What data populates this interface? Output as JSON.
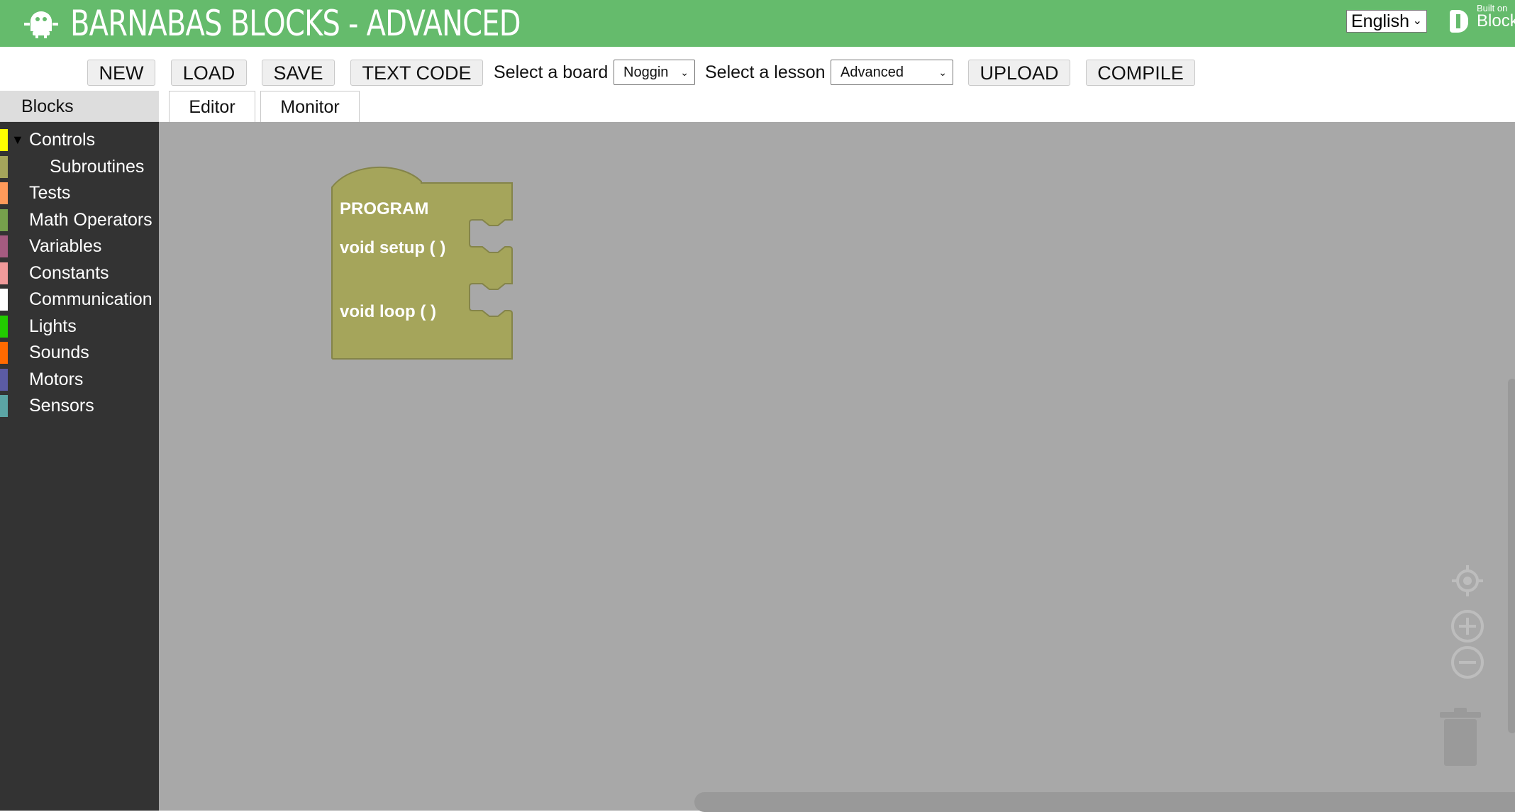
{
  "header": {
    "title": "BARNABAS BLOCKS - ADVANCED",
    "logo_icon": "robot-icon",
    "language": "English",
    "built_on_small": "Built on",
    "built_on_big": "Block"
  },
  "toolbar": {
    "new_label": "NEW",
    "load_label": "LOAD",
    "save_label": "SAVE",
    "text_code_label": "TEXT CODE",
    "board_label": "Select a board",
    "board_value": "Noggin",
    "lesson_label": "Select a lesson",
    "lesson_value": "Advanced",
    "upload_label": "UPLOAD",
    "compile_label": "COMPILE"
  },
  "tabs": {
    "blocks": "Blocks",
    "editor": "Editor",
    "monitor": "Monitor"
  },
  "sidebar": {
    "items": [
      {
        "label": "Controls",
        "color": "#ffff00"
      },
      {
        "label": "Subroutines",
        "color": "#a5a55b"
      },
      {
        "label": "Tests",
        "color": "#ff9a5a"
      },
      {
        "label": "Math Operators",
        "color": "#76a04c"
      },
      {
        "label": "Variables",
        "color": "#a55b80"
      },
      {
        "label": "Constants",
        "color": "#f09a9a"
      },
      {
        "label": "Communication",
        "color": "#ffffff"
      },
      {
        "label": "Lights",
        "color": "#22cc00"
      },
      {
        "label": "Sounds",
        "color": "#ff6a00"
      },
      {
        "label": "Motors",
        "color": "#5b5ba5"
      },
      {
        "label": "Sensors",
        "color": "#5ba5a5"
      }
    ]
  },
  "workspace": {
    "program_block": {
      "title": "PROGRAM",
      "setup_label": "void setup ( )",
      "loop_label": "void loop ( )",
      "color": "#a5a55b"
    },
    "controls": {
      "recenter_icon": "recenter-icon",
      "zoom_in_icon": "zoom-in-icon",
      "zoom_out_icon": "zoom-out-icon",
      "trash_icon": "trash-icon"
    }
  }
}
